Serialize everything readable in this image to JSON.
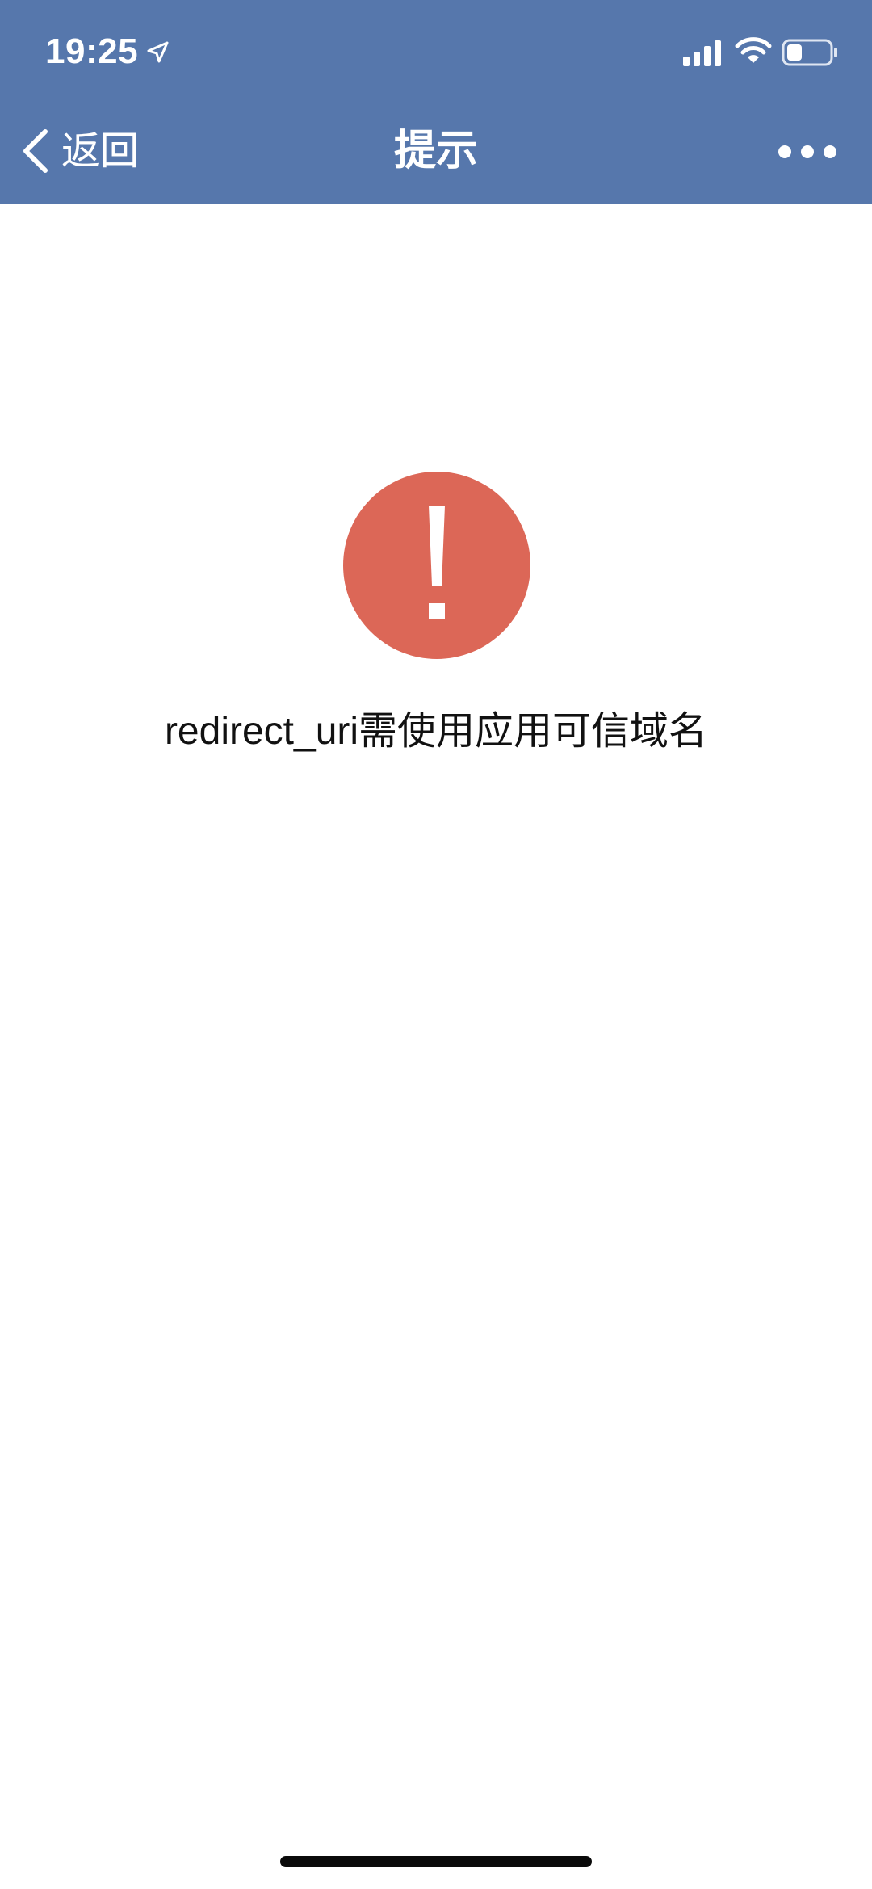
{
  "status_bar": {
    "time": "19:25",
    "icons": [
      "location-arrow-icon",
      "signal-icon",
      "wifi-icon",
      "battery-icon"
    ]
  },
  "nav_bar": {
    "back_label": "返回",
    "title": "提示",
    "more_icon": "more-dots-icon",
    "background_color": "#5677AC"
  },
  "main": {
    "alert_icon": "exclamation-icon",
    "alert_color": "#DC6757",
    "message": "redirect_uri需使用应用可信域名"
  }
}
